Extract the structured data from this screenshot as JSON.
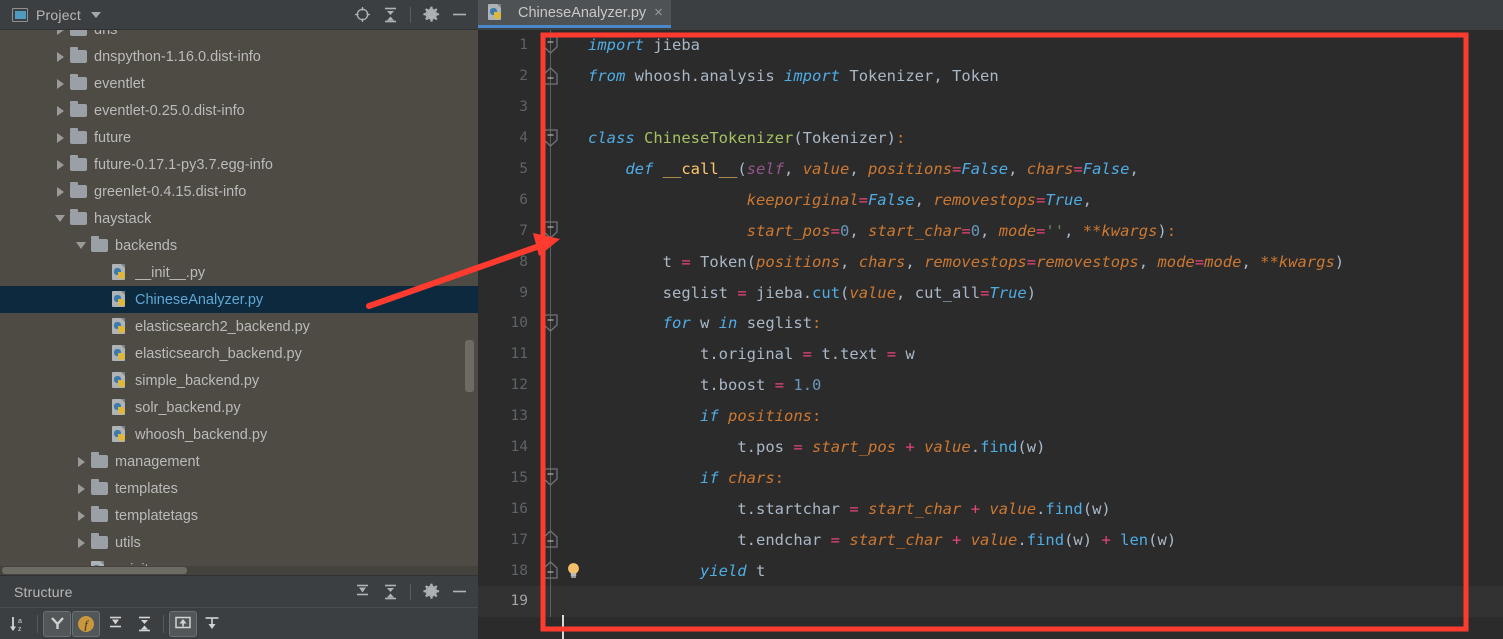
{
  "project_panel": {
    "title": "Project",
    "icons": [
      "project-view-icon",
      "locate-icon",
      "collapse-all-icon",
      "settings-gear-icon",
      "hide-panel-icon"
    ],
    "tree": [
      {
        "label": "dns",
        "type": "folder",
        "expanded": false,
        "depth": 2
      },
      {
        "label": "dnspython-1.16.0.dist-info",
        "type": "folder",
        "expanded": false,
        "depth": 2
      },
      {
        "label": "eventlet",
        "type": "folder",
        "expanded": false,
        "depth": 2
      },
      {
        "label": "eventlet-0.25.0.dist-info",
        "type": "folder",
        "expanded": false,
        "depth": 2
      },
      {
        "label": "future",
        "type": "folder",
        "expanded": false,
        "depth": 2
      },
      {
        "label": "future-0.17.1-py3.7.egg-info",
        "type": "folder",
        "expanded": false,
        "depth": 2
      },
      {
        "label": "greenlet-0.4.15.dist-info",
        "type": "folder",
        "expanded": false,
        "depth": 2
      },
      {
        "label": "haystack",
        "type": "folder",
        "expanded": true,
        "depth": 2
      },
      {
        "label": "backends",
        "type": "folder",
        "expanded": true,
        "depth": 3
      },
      {
        "label": "__init__.py",
        "type": "python",
        "depth": 4
      },
      {
        "label": "ChineseAnalyzer.py",
        "type": "python",
        "depth": 4,
        "selected": true
      },
      {
        "label": "elasticsearch2_backend.py",
        "type": "python",
        "depth": 4
      },
      {
        "label": "elasticsearch_backend.py",
        "type": "python",
        "depth": 4
      },
      {
        "label": "simple_backend.py",
        "type": "python",
        "depth": 4
      },
      {
        "label": "solr_backend.py",
        "type": "python",
        "depth": 4
      },
      {
        "label": "whoosh_backend.py",
        "type": "python",
        "depth": 4
      },
      {
        "label": "management",
        "type": "folder",
        "expanded": false,
        "depth": 3
      },
      {
        "label": "templates",
        "type": "folder",
        "expanded": false,
        "depth": 3
      },
      {
        "label": "templatetags",
        "type": "folder",
        "expanded": false,
        "depth": 3
      },
      {
        "label": "utils",
        "type": "folder",
        "expanded": false,
        "depth": 3
      },
      {
        "label": "__init__.py",
        "type": "python",
        "depth": 3
      }
    ]
  },
  "structure_panel": {
    "title": "Structure",
    "header_icons": [
      "expand-all-icon",
      "collapse-all-icon",
      "settings-gear-icon",
      "hide-panel-icon"
    ],
    "toolbar_icons": [
      "sort-alphabetically-icon",
      "show-inherited-icon",
      "show-fields-icon",
      "expand-all-icon",
      "collapse-all-icon",
      "autoscroll-to-source-icon",
      "autoscroll-from-source-icon"
    ]
  },
  "editor": {
    "tab": {
      "label": "ChineseAnalyzer.py",
      "icon": "python-file-icon",
      "close_label": "×"
    },
    "current_line": 19,
    "lines": [
      {
        "n": 1,
        "fold": "open",
        "bulb": false
      },
      {
        "n": 2,
        "fold": "close",
        "bulb": false
      },
      {
        "n": 3,
        "fold": null,
        "bulb": false
      },
      {
        "n": 4,
        "fold": "open",
        "bulb": false
      },
      {
        "n": 5,
        "fold": null,
        "bulb": false
      },
      {
        "n": 6,
        "fold": null,
        "bulb": false
      },
      {
        "n": 7,
        "fold": "open",
        "bulb": false
      },
      {
        "n": 8,
        "fold": null,
        "bulb": false
      },
      {
        "n": 9,
        "fold": null,
        "bulb": false
      },
      {
        "n": 10,
        "fold": "open",
        "bulb": false
      },
      {
        "n": 11,
        "fold": null,
        "bulb": false
      },
      {
        "n": 12,
        "fold": null,
        "bulb": false
      },
      {
        "n": 13,
        "fold": null,
        "bulb": false
      },
      {
        "n": 14,
        "fold": null,
        "bulb": false
      },
      {
        "n": 15,
        "fold": "open",
        "bulb": false
      },
      {
        "n": 16,
        "fold": null,
        "bulb": false
      },
      {
        "n": 17,
        "fold": "close",
        "bulb": false
      },
      {
        "n": 18,
        "fold": "close",
        "bulb": true
      },
      {
        "n": 19,
        "fold": null,
        "bulb": false
      }
    ],
    "source_text": [
      "import jieba",
      "from whoosh.analysis import Tokenizer, Token",
      "",
      "class ChineseTokenizer(Tokenizer):",
      "    def __call__(self, value, positions=False, chars=False,",
      "                 keeporiginal=False, removestops=True,",
      "                 start_pos=0, start_char=0, mode='', **kwargs):",
      "        t = Token(positions, chars, removestops=removestops, mode=mode, **kwargs)",
      "        seglist = jieba.cut(value, cut_all=True)",
      "        for w in seglist:",
      "            t.original = t.text = w",
      "            t.boost = 1.0",
      "            if positions:",
      "                t.pos = start_pos + value.find(w)",
      "            if chars:",
      "                t.startchar = start_char + value.find(w)",
      "                t.endchar = start_char + value.find(w) + len(w)",
      "            yield t",
      ""
    ]
  },
  "annotations": {
    "highlight_color": "#ff3b30",
    "rectangle_label": "code-area-highlight-rectangle",
    "arrow_label": "pointer-arrow-to-fold-marker"
  },
  "colors": {
    "tree_background": "#4e4a44",
    "selection": "#0d293e",
    "editor_background": "#2b2b2b",
    "panel_background": "#3c3f41",
    "tab_accent": "#4a88c7",
    "annotation_red": "#ff3b30"
  }
}
